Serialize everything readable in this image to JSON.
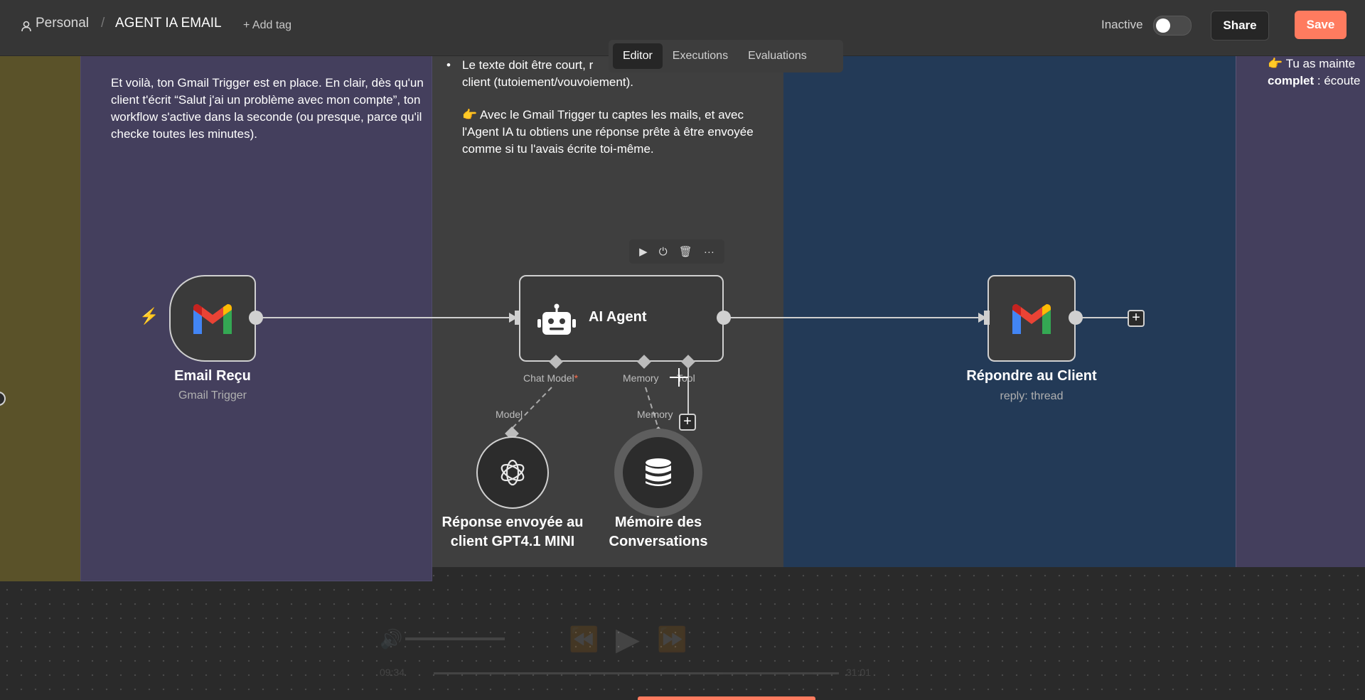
{
  "header": {
    "workspace": "Personal",
    "separator": "/",
    "workflow_name": "AGENT IA EMAIL",
    "add_tag": "+ Add tag",
    "status_label": "Inactive",
    "share_label": "Share",
    "save_label": "Save"
  },
  "tabs": [
    {
      "label": "Editor",
      "active": true
    },
    {
      "label": "Executions",
      "active": false
    },
    {
      "label": "Evaluations",
      "active": false
    }
  ],
  "notes": {
    "gmail_note": "Et voilà, ton Gmail Trigger est en place. En clair, dès qu'un client t'écrit “Salut j'ai un problème avec mon compte”, ton workflow s'active dans la seconde (ou presque, parce qu'il checke toutes les minutes).",
    "agent_note_bullet": "Le texte doit être court, r",
    "agent_note_line2": "client (tutoiement/vouvoiement).",
    "agent_note_para": "Avec le Gmail Trigger tu captes les mails, et avec l'Agent IA tu obtiens une réponse prête à être envoyée comme si tu l'avais écrite toi-même.",
    "right_note_line1": "Tu as mainte",
    "right_note_bold": "complet",
    "right_note_rest": " : écoute"
  },
  "nodes": {
    "email_recu": {
      "title": "Email Reçu",
      "subtitle": "Gmail Trigger"
    },
    "ai_agent": {
      "title": "AI Agent"
    },
    "repondre": {
      "title": "Répondre au Client",
      "subtitle": "reply: thread"
    },
    "gpt": {
      "title_line1": "Réponse envoyée au",
      "title_line2": "client GPT4.1 MINI"
    },
    "memory": {
      "title_line1": "Mémoire des",
      "title_line2": "Conversations"
    }
  },
  "handles": {
    "chat_model": "Chat Model",
    "chat_model_required": "*",
    "memory": "Memory",
    "tool": "Tool",
    "model_port": "Model",
    "memory_port": "Memory"
  },
  "video": {
    "time_current": "09:34",
    "time_total": "31:01"
  },
  "colors": {
    "accent": "#ff7b5f",
    "note_olive": "#5a5229",
    "note_purple": "#443f5d",
    "note_gray": "#3f3f3f",
    "note_blue": "#233a57"
  }
}
